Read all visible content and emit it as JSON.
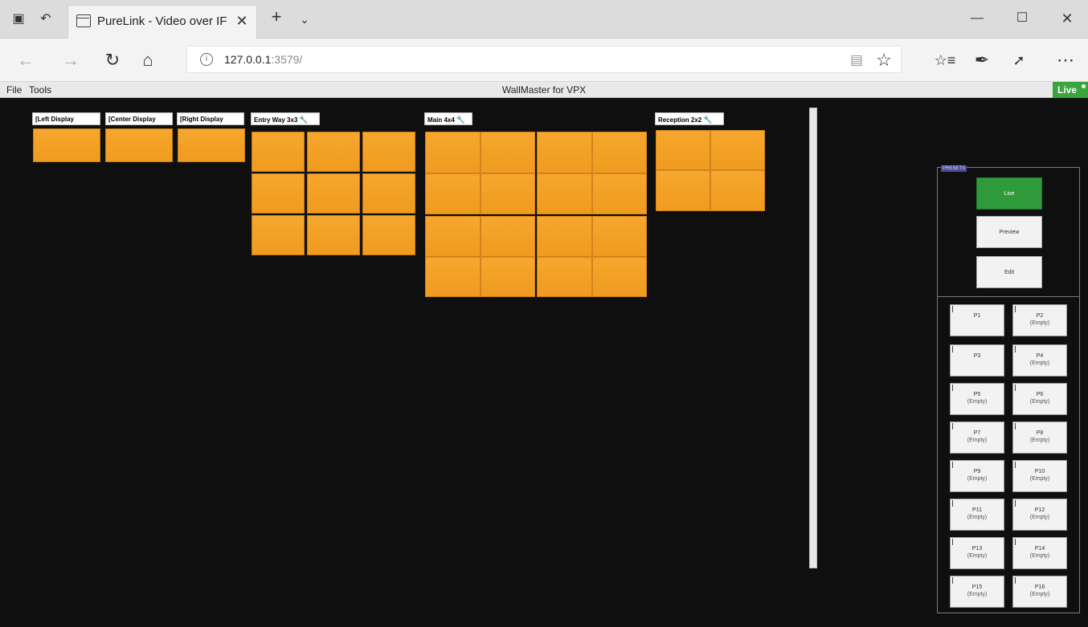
{
  "browser": {
    "tab_title": "PureLink - Video over IF",
    "url_host": "127.0.0.1",
    "url_rest": ":3579/"
  },
  "app": {
    "menu_file": "File",
    "menu_tools": "Tools",
    "title": "WallMaster for VPX",
    "live_badge": "Live"
  },
  "walls": {
    "left": "[Left Display",
    "center": "[Center Display",
    "right": "[Right Display",
    "entry": "Entry Way 3x3",
    "main": "Main 4x4",
    "reception": "Reception 2x2"
  },
  "presets": {
    "legend": "PRESETS",
    "live": "Live",
    "preview": "Preview",
    "edit": "Edit",
    "items": [
      {
        "name": "P1",
        "state": ""
      },
      {
        "name": "P2",
        "state": "(Empty)"
      },
      {
        "name": "P3",
        "state": ""
      },
      {
        "name": "P4",
        "state": "(Empty)"
      },
      {
        "name": "P5",
        "state": "(Empty)"
      },
      {
        "name": "P6",
        "state": "(Empty)"
      },
      {
        "name": "P7",
        "state": "(Empty)"
      },
      {
        "name": "P8",
        "state": "(Empty)"
      },
      {
        "name": "P9",
        "state": "(Empty)"
      },
      {
        "name": "P10",
        "state": "(Empty)"
      },
      {
        "name": "P11",
        "state": "(Empty)"
      },
      {
        "name": "P12",
        "state": "(Empty)"
      },
      {
        "name": "P13",
        "state": "(Empty)"
      },
      {
        "name": "P14",
        "state": "(Empty)"
      },
      {
        "name": "P15",
        "state": "(Empty)"
      },
      {
        "name": "P16",
        "state": "(Empty)"
      }
    ]
  },
  "colors": {
    "tile": "#f6a72d",
    "live_green": "#2e9a3a",
    "canvas_bg": "#0f0f0f"
  }
}
